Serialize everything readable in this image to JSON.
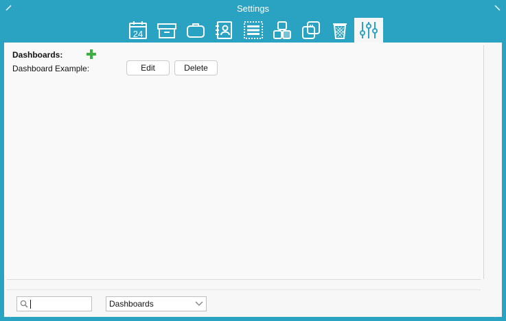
{
  "window": {
    "title": "Settings"
  },
  "toolbar": {
    "items": [
      {
        "name": "calendar",
        "icon": "calendar-icon",
        "label": "24"
      },
      {
        "name": "archive",
        "icon": "archive-box-icon"
      },
      {
        "name": "briefcase",
        "icon": "briefcase-icon"
      },
      {
        "name": "contacts",
        "icon": "address-book-icon"
      },
      {
        "name": "list",
        "icon": "list-icon"
      },
      {
        "name": "blocks",
        "icon": "blocks-icon"
      },
      {
        "name": "copy",
        "icon": "copy-icon"
      },
      {
        "name": "trash",
        "icon": "trash-icon"
      },
      {
        "name": "sliders",
        "icon": "sliders-icon",
        "active": true
      }
    ]
  },
  "dashboards": {
    "heading": "Dashboards:",
    "items": [
      {
        "label": "Dashboard Example:",
        "edit_label": "Edit",
        "delete_label": "Delete"
      }
    ]
  },
  "footer": {
    "search": {
      "value": "",
      "placeholder": ""
    },
    "select": {
      "selected": "Dashboards"
    }
  },
  "colors": {
    "accent": "#2aa3c2",
    "add": "#3cb043",
    "background": "#f7f7f7"
  }
}
